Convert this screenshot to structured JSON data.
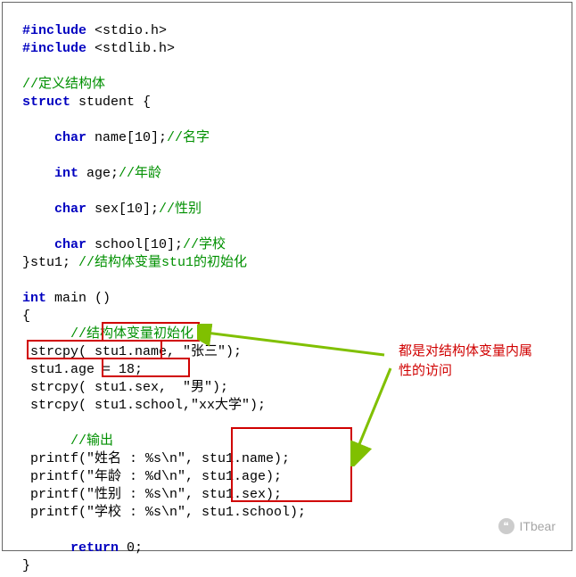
{
  "code": {
    "l1_a": "#include",
    "l1_b": " <stdio.h>",
    "l2_a": "#include",
    "l2_b": " <stdlib.h>",
    "l3": "",
    "l4_cm": "//定义结构体",
    "l5_a": "struct",
    "l5_b": " student {",
    "l6": "",
    "l7_a": "    char",
    "l7_b": " name[10];",
    "l7_cm": "//名字",
    "l8": "",
    "l9_a": "    int",
    "l9_b": " age;",
    "l9_cm": "//年龄",
    "l10": "",
    "l11_a": "    char",
    "l11_b": " sex[10];",
    "l11_cm": "//性别",
    "l12": "",
    "l13_a": "    char",
    "l13_b": " school[10];",
    "l13_cm": "//学校",
    "l14_a": "}stu1; ",
    "l14_cm": "//结构体变量stu1的初始化",
    "l15": "",
    "l16_a": "int",
    "l16_b": " main ()",
    "l17": "{",
    "l18_cm": "      //结构体变量初始化",
    "l19": " strcpy( stu1.name, \"张三\");",
    "l20": " stu1.age = 18;",
    "l21": " strcpy( stu1.sex,  \"男\");",
    "l22": " strcpy( stu1.school,\"xx大学\");",
    "l23": "",
    "l24_cm": "      //输出",
    "l25": " printf(\"姓名 : %s\\n\", stu1.name);",
    "l26": " printf(\"年龄 : %d\\n\", stu1.age);",
    "l27": " printf(\"性别 : %s\\n\", stu1.sex);",
    "l28": " printf(\"学校 : %s\\n\", stu1.school);",
    "l29": "",
    "l30_a": "      return",
    "l30_b": " 0;",
    "l31": "}"
  },
  "annotation": {
    "line1": "都是对结构体变量内属",
    "line2": "性的访问"
  },
  "watermark": "ITbear"
}
